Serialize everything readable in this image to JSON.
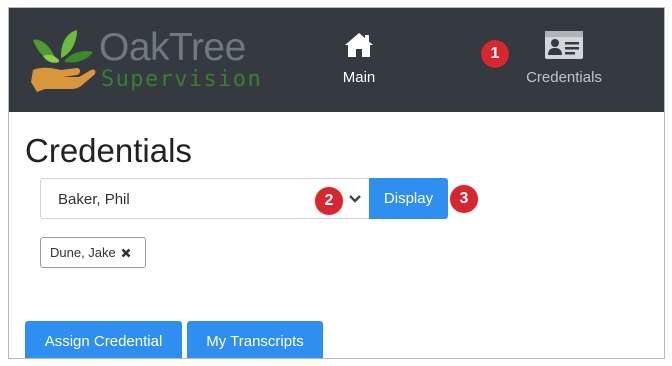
{
  "brand": {
    "name": "OakTree",
    "tagline": "Supervision"
  },
  "nav": {
    "main": {
      "label": "Main",
      "icon": "home-icon"
    },
    "credentials": {
      "label": "Credentials",
      "icon": "id-card-icon"
    }
  },
  "callouts": {
    "one": "1",
    "two": "2",
    "three": "3"
  },
  "page": {
    "title": "Credentials"
  },
  "picker": {
    "selected": "Baker, Phil",
    "display_label": "Display"
  },
  "tags": [
    {
      "label": "Dune, Jake"
    }
  ],
  "actions": {
    "assign_label": "Assign Credential",
    "transcripts_label": "My Transcripts"
  },
  "colors": {
    "navbar": "#343a40",
    "primary": "#2e8ff0",
    "callout": "#d6272f",
    "brand_green": "#3a7f2f",
    "brand_gray": "#6e7a83"
  }
}
